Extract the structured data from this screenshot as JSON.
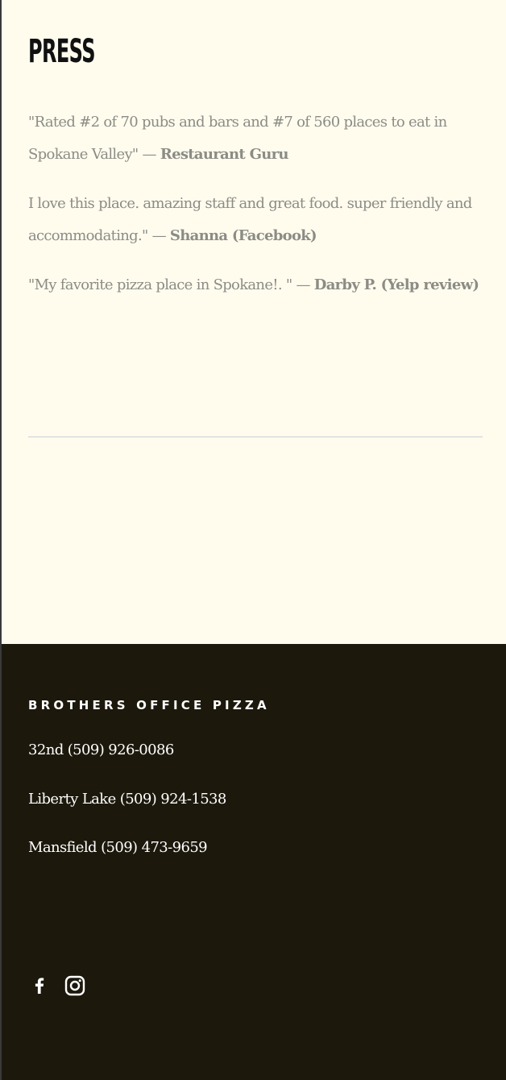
{
  "press": {
    "title": "PRESS",
    "quotes": [
      {
        "text": "\"Rated #2 of 70 pubs and bars  and #7 of 560 places to eat in Spokane Valley\" — ",
        "source": "Restaurant Guru"
      },
      {
        "text": "I love this place. amazing staff and great food. super friendly and accommodating.\" — ",
        "source": "Shanna (Facebook)"
      },
      {
        "text": "\"My favorite pizza place in Spokane!. \" — ",
        "source": "Darby P. (Yelp review)"
      }
    ]
  },
  "footer": {
    "brand": "BROTHERS OFFICE PIZZA",
    "locations": [
      "32nd (509) 926-0086",
      "Liberty Lake (509) 924-1538",
      "Mansfield (509) 473-9659"
    ],
    "social": [
      {
        "icon": "facebook-icon"
      },
      {
        "icon": "instagram-icon"
      }
    ]
  },
  "colors": {
    "page_background": "#fffcee",
    "footer_background": "#1c180c",
    "quote_text": "#8c8c85",
    "divider": "#e3e3e3"
  }
}
